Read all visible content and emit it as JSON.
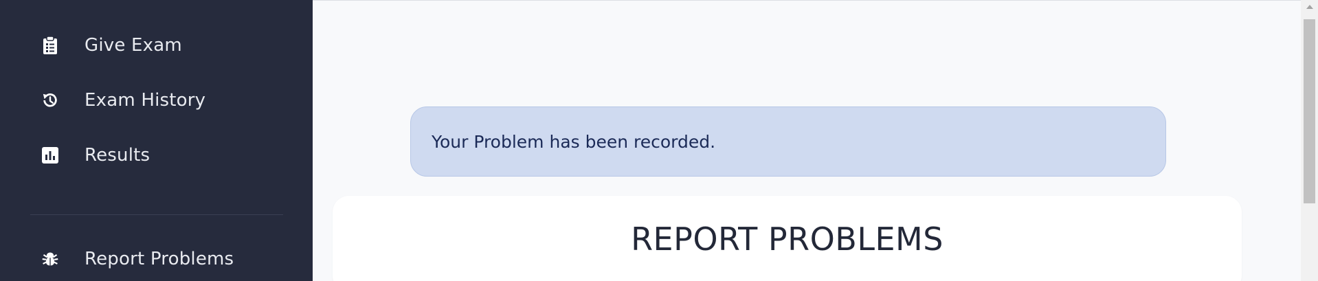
{
  "sidebar": {
    "items": [
      {
        "label": "Give Exam",
        "icon": "clipboard-icon"
      },
      {
        "label": "Exam History",
        "icon": "history-icon"
      },
      {
        "label": "Results",
        "icon": "chart-icon"
      },
      {
        "label": "Report Problems",
        "icon": "bug-icon"
      }
    ]
  },
  "main": {
    "alert": {
      "message": "Your Problem has been recorded."
    },
    "card": {
      "title": "REPORT PROBLEMS"
    }
  },
  "colors": {
    "sidebar_bg": "#262b3d",
    "alert_bg": "#cfdaf0",
    "alert_text": "#1b2a57"
  }
}
